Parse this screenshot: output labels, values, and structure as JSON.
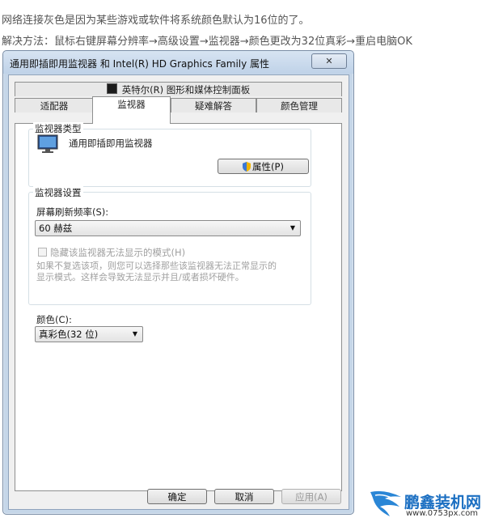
{
  "article": {
    "line1": "网络连接灰色是因为某些游戏或软件将系统颜色默认为16位的了。",
    "line2": "解决方法：鼠标右键屏幕分辨率→高级设置→监视器→颜色更改为32位真彩→重启电脑OK"
  },
  "dialog": {
    "title": "通用即插即用监视器 和 Intel(R) HD Graphics Family 属性",
    "close_label": "✕",
    "tabs_row1": [
      {
        "label": "英特尔(R) 图形和媒体控制面板"
      }
    ],
    "tabs_row2": [
      {
        "label": "适配器"
      },
      {
        "label": "监视器",
        "selected": true
      },
      {
        "label": "疑难解答"
      },
      {
        "label": "颜色管理"
      }
    ],
    "monitor_type": {
      "group_label": "监视器类型",
      "monitor_name": "通用即插即用监视器",
      "properties_button": "属性(P)"
    },
    "monitor_settings": {
      "group_label": "监视器设置",
      "refresh_rate_label": "屏幕刷新频率(S):",
      "refresh_rate_value": "60 赫兹",
      "hide_modes_label": "隐藏该监视器无法显示的模式(H)",
      "hide_modes_checked": false,
      "hint_line1": "如果不复选该项，则您可以选择那些该监视器无法正常显示的",
      "hint_line2": "显示模式。这样会导致无法显示并且/或者损坏硬件。"
    },
    "colors": {
      "label": "颜色(C):",
      "value": "真彩色(32 位)"
    },
    "buttons": {
      "ok": "确定",
      "cancel": "取消",
      "apply": "应用(A)"
    }
  },
  "watermark": {
    "brand": "鹏鑫装机网",
    "url": "www.0753px.com"
  }
}
